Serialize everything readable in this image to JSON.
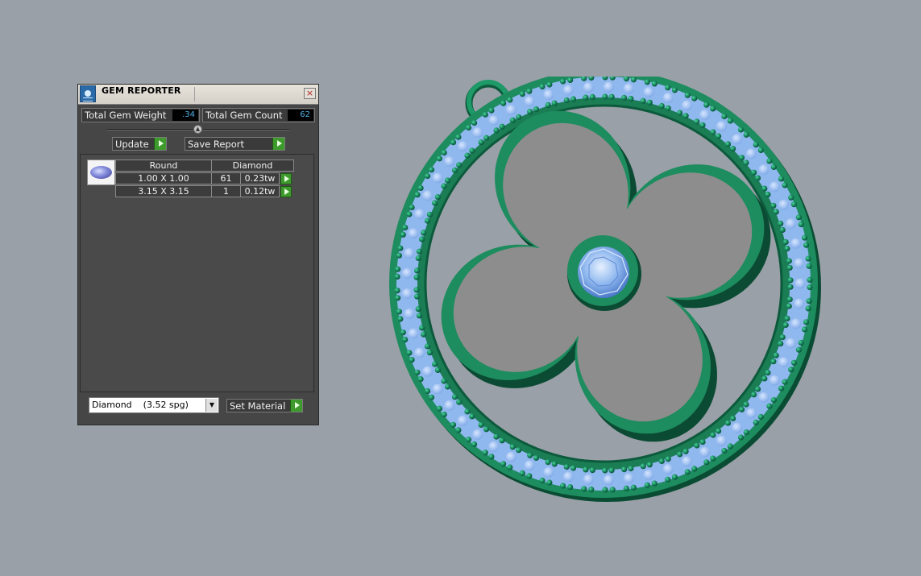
{
  "panel": {
    "title": "GEM REPORTER",
    "close_glyph": "×",
    "total_gem_weight_label": "Total Gem Weight",
    "total_gem_weight_value": ".34",
    "total_gem_count_label": "Total Gem Count",
    "total_gem_count_value": "62",
    "update_label": "Update",
    "save_report_label": "Save Report",
    "table": {
      "headers": [
        "Round",
        "Diamond"
      ],
      "rows": [
        {
          "size": "1.00 X 1.00",
          "count": "61",
          "weight": "0.23tw"
        },
        {
          "size": "3.15 X 3.15",
          "count": "1",
          "weight": "0.12tw"
        }
      ]
    },
    "material_select_value": "Diamond    (3.52 spg)",
    "set_material_label": "Set Material"
  },
  "icons": {
    "app": "gem-reporter-icon",
    "close": "close-icon",
    "splitter": "splitter-collapse-icon",
    "play": "green-play-arrow-icon",
    "dropdown": "chevron-down-icon",
    "gem": "round-diamond-thumbnail-icon"
  },
  "colors": {
    "viewport_background": "#99a0a7",
    "panel_background": "#464646",
    "metal_green": "#1d8c5e",
    "gem_blue": "#8fb8ee",
    "plate_gray": "#8d8d8d",
    "value_text": "#4fb0e8",
    "play_button": "#3e9a2c"
  }
}
